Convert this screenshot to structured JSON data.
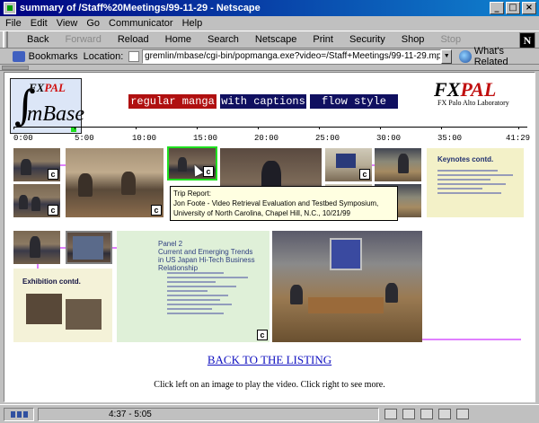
{
  "window": {
    "title": "summary of /Staff%20Meetings/99-11-29 - Netscape"
  },
  "menu": [
    "File",
    "Edit",
    "View",
    "Go",
    "Communicator",
    "Help"
  ],
  "toolbar": {
    "back": "Back",
    "forward": "Forward",
    "reload": "Reload",
    "home": "Home",
    "search": "Search",
    "netscape": "Netscape",
    "print": "Print",
    "security": "Security",
    "shop": "Shop",
    "stop": "Stop"
  },
  "location": {
    "bookmarks": "Bookmarks",
    "label": "Location:",
    "url": "gremlin/mbase/cgi-bin/popmanga.exe?video=/Staff+Meetings/99-11-29.mpg&cols=10",
    "related": "What's Related"
  },
  "page": {
    "logo_fx": "FX",
    "logo_pal": "PAL",
    "logo_mbase": "mBase",
    "view_buttons": [
      "regular manga",
      "with captions",
      "flow style"
    ],
    "fxpal_fx": "FX",
    "fxpal_pal": "PAL",
    "fxpal_sub": "FX Palo Alto Laboratory",
    "timeline_labels": [
      "0:00",
      "5:00",
      "10:00",
      "15:00",
      "20:00",
      "25:00",
      "30:00",
      "35:00",
      "41:29"
    ],
    "badge": "c",
    "slide_keynotes": "Keynotes contd.",
    "slide_exhibition": "Exhibition contd.",
    "slide_panel": "Panel 2\nCurrent and Emerging Trends in US Japan Hi-Tech Business Relationship",
    "tooltip": {
      "line1": "Trip Report:",
      "line2": "Jon Foote - Video Retrieval Evaluation and Testbed Symposium,",
      "line3": "University of North Carolina, Chapel Hill, N.C., 10/21/99"
    },
    "back_link": "BACK TO THE LISTING",
    "help_text": "Click left on an image to play the video. Click right to see more."
  },
  "status": {
    "text": "4:37 - 5:05"
  },
  "colors": {
    "manga_button": "#b01010",
    "other_buttons": "#101060",
    "link": "#1010c0"
  }
}
